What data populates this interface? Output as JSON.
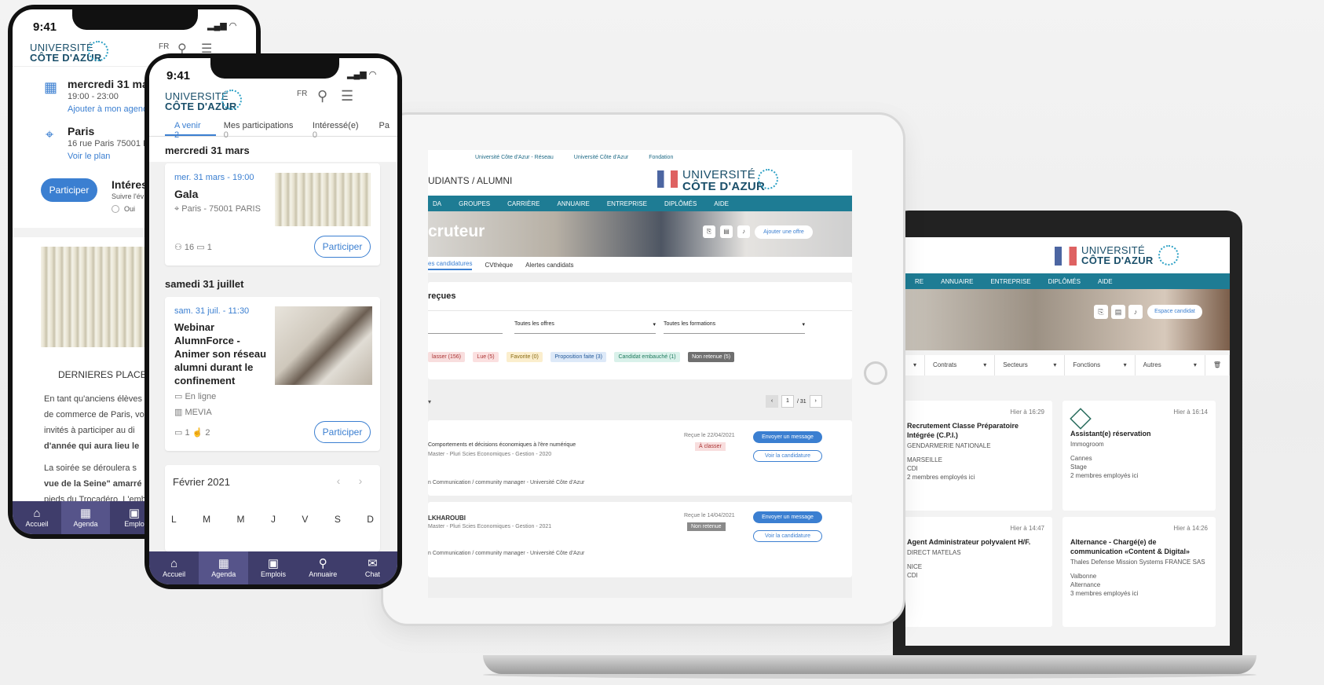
{
  "laptop": {
    "logo": {
      "line1": "UNIVERSITÉ",
      "line2": "CÔTE D'AZUR"
    },
    "nav": [
      "RE",
      "ANNUAIRE",
      "ENTREPRISE",
      "DIPLÔMÉS",
      "AIDE"
    ],
    "espace_label": "Espace candidat",
    "filters": [
      "Contrats",
      "Secteurs",
      "Fonctions",
      "Autres"
    ],
    "cards": [
      {
        "date": "Hier à 16:29",
        "title": "Recrutement Classe Préparatoire Intégrée (C.P.I.)",
        "company": "GENDARMERIE NATIONALE",
        "meta": [
          "MARSEILLE",
          "CDI",
          "2 membres employés ici"
        ]
      },
      {
        "date": "Hier à 16:14",
        "title": "Assistant(e) réservation",
        "company": "Immogroom",
        "meta": [
          "Cannes",
          "Stage",
          "2 membres employés ici"
        ]
      },
      {
        "date": "Hier à 14:47",
        "title": "Agent Administrateur polyvalent H/F.",
        "company": "DIRECT MATELAS",
        "meta": [
          "NICE",
          "CDI"
        ]
      },
      {
        "date": "Hier à 14:26",
        "title": "Alternance - Chargé(e) de communication «Content & Digital»",
        "company": "Thales Defense Mission Systems FRANCE SAS",
        "meta": [
          "Valbonne",
          "Alternance",
          "3 membres employés ici"
        ]
      }
    ]
  },
  "tablet": {
    "top_links": [
      "Université Côte d'Azur - Réseau",
      "Université Côte d'Azur",
      "Fondation"
    ],
    "brand": "UDIANTS / ALUMNI",
    "logo": {
      "line1": "UNIVERSITÉ",
      "line2": "CÔTE D'AZUR"
    },
    "nav": [
      "DA",
      "GROUPES",
      "CARRIÈRE",
      "ANNUAIRE",
      "ENTREPRISE",
      "DIPLÔMÉS",
      "AIDE"
    ],
    "banner_title": "cruteur",
    "add_offer": "Ajouter une offre",
    "tabs": [
      "es candidatures",
      "CVthèque",
      "Alertes candidats"
    ],
    "panel_title": "reçues",
    "selects": [
      "Toutes les offres",
      "Toutes les formations"
    ],
    "status_pills": [
      "lasser (156)",
      "Lue (5)",
      "Favorite (0)",
      "Proposition faite (3)",
      "Candidat embauché (1)",
      "Non retenue (5)"
    ],
    "pager": {
      "page": "1",
      "total": "/ 31"
    },
    "applications": [
      {
        "title": "Comportements et décisions économiques à l'ère numérique",
        "sub": "Master - Pluri Scies Economiques - Gestion - 2020",
        "received": "Reçue le 22/04/2021",
        "status": "À classer",
        "extra": "n Communication / community manager - Université Côte d'Azur"
      },
      {
        "title": "LKHAROUBI",
        "sub": "Master - Pluri Scies Economiques - Gestion - 2021",
        "received": "Reçue le 14/04/2021",
        "status": "Non retenue",
        "extra": "n Communication / community manager - Université Côte d'Azur"
      }
    ],
    "send_message": "Envoyer un message",
    "view_application": "Voir la candidature"
  },
  "phone_back": {
    "time": "9:41",
    "logo": {
      "line1": "UNIVERSITÉ",
      "line2": "CÔTE D'AZUR"
    },
    "lang": "FR",
    "date_line": "mercredi 31 mar",
    "time_range": "19:00 - 23:00",
    "add_agenda": "Ajouter à mon agend",
    "city": "Paris",
    "address": "16 rue Paris 75001 P",
    "see_map": "Voir le plan",
    "participate": "Participer",
    "interest": "Intéres",
    "follow": "Suivre l'év",
    "yes": "Oui",
    "section": "DERNIERES PLACE",
    "paragraph1": [
      "En tant qu'anciens élèves",
      "de commerce de Paris, vo",
      "invités à participer au di",
      "d'année qui aura lieu le"
    ],
    "paragraph2": [
      "La soirée se déroulera s",
      "vue de la Seine\" amarré",
      "pieds du Trocadéro. L'emb"
    ],
    "nav": [
      {
        "g": "⌂",
        "label": "Accueil"
      },
      {
        "g": "▦",
        "label": "Agenda"
      },
      {
        "g": "▣",
        "label": "Emplo"
      }
    ]
  },
  "phone_front": {
    "time": "9:41",
    "logo": {
      "line1": "UNIVERSITÉ",
      "line2": "CÔTE D'AZUR"
    },
    "lang": "FR",
    "tabs": [
      {
        "label": "A venir",
        "count": "2"
      },
      {
        "label": "Mes participations",
        "count": "0"
      },
      {
        "label": "Intéressé(e)",
        "count": "0"
      },
      {
        "label": "Pa",
        "count": ""
      }
    ],
    "day1": "mercredi 31 mars",
    "ev1": {
      "date": "mer. 31 mars - 19:00",
      "title": "Gala",
      "place": "Paris - 75001 PARIS",
      "people": "16",
      "comments": "1",
      "button": "Participer"
    },
    "day2": "samedi 31 juillet",
    "ev2": {
      "date": "sam. 31 juil. - 11:30",
      "title_lines": [
        "Webinar",
        "AlumnForce -",
        "Animer son réseau",
        "alumni durant le",
        "confinement"
      ],
      "mode": "En ligne",
      "org": "MEVIA",
      "comments": "1",
      "likes": "2",
      "button": "Participer"
    },
    "calendar": {
      "month": "Février 2021",
      "days": [
        "L",
        "M",
        "M",
        "J",
        "V",
        "S",
        "D"
      ]
    },
    "nav": [
      {
        "g": "⌂",
        "label": "Accueil"
      },
      {
        "g": "▦",
        "label": "Agenda"
      },
      {
        "g": "▣",
        "label": "Emplois"
      },
      {
        "g": "⚲",
        "label": "Annuaire"
      },
      {
        "g": "✉",
        "label": "Chat"
      }
    ]
  }
}
